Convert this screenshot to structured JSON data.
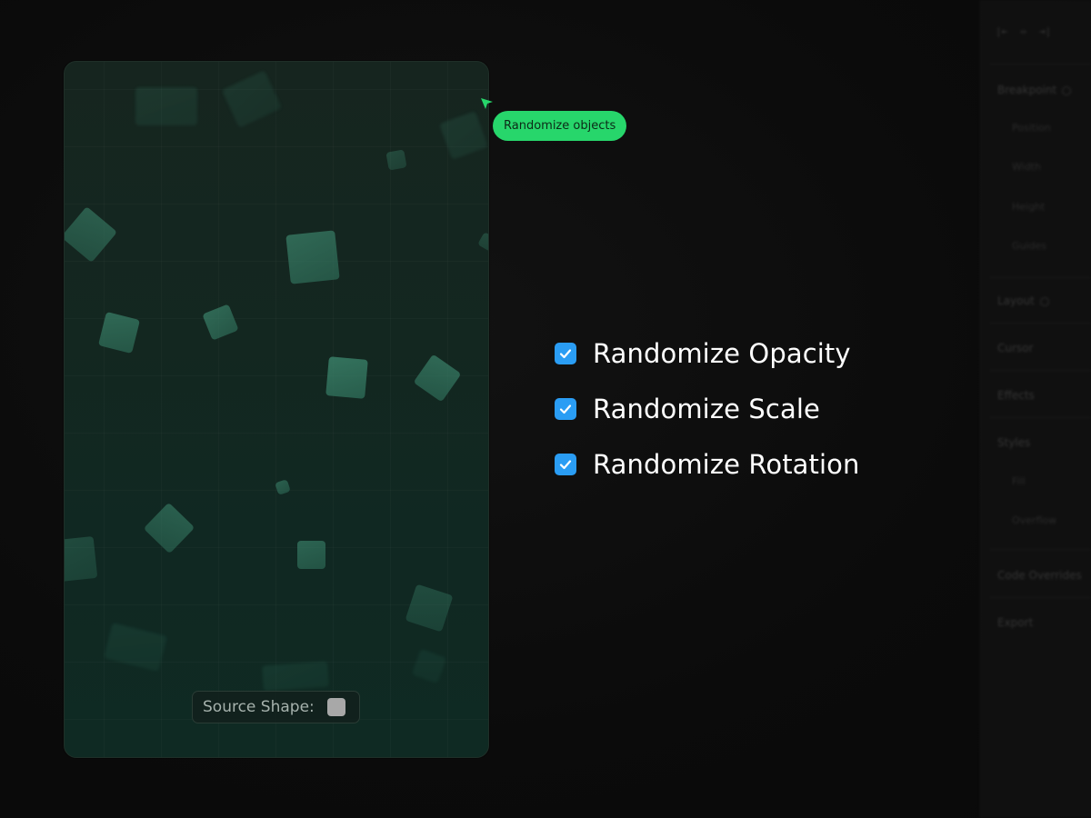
{
  "canvas": {
    "source_shape_label": "Source Shape:",
    "source_shape_color": "#a8a8a8",
    "accent_color": "#3f8c72"
  },
  "tooltip": {
    "label": "Randomize objects",
    "color": "#27d66b"
  },
  "options": [
    {
      "label": "Randomize Opacity",
      "checked": true
    },
    {
      "label": "Randomize Scale",
      "checked": true
    },
    {
      "label": "Randomize Rotation",
      "checked": true
    }
  ],
  "checkbox_color": "#2a9df4",
  "side_panel": {
    "sections": [
      "Breakpoint",
      "Position",
      "Width",
      "Height",
      "Guides",
      "Layout",
      "Cursor",
      "Effects",
      "Styles",
      "Fill",
      "Overflow",
      "Code Overrides",
      "Export"
    ]
  }
}
